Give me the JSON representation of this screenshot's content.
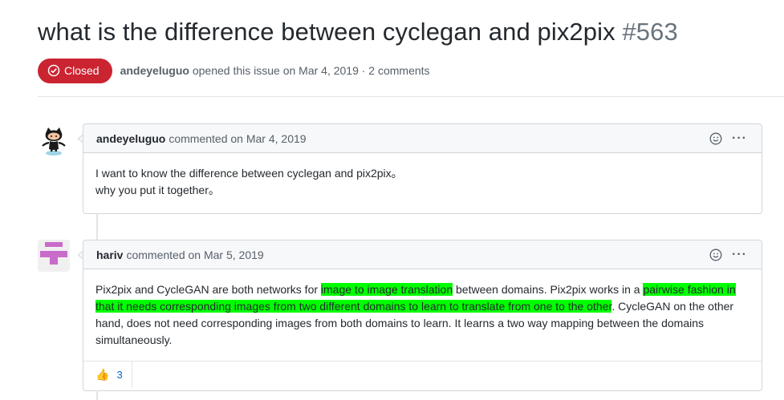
{
  "issue": {
    "title": "what is the difference between cyclegan and pix2pix",
    "number": "#563",
    "state_label": "Closed",
    "author": "andeyeluguo",
    "opened_text": "opened this issue on Mar 4, 2019 · 2 comments",
    "colors": {
      "closed": "#cb2431",
      "highlight": "#00ff00",
      "link": "#0366d6"
    }
  },
  "comments": [
    {
      "author": "andeyeluguo",
      "action": "commented on Mar 4, 2019",
      "avatar_icon": "octocat-icon",
      "lines": [
        "I want to know the difference between cyclegan and pix2pix。",
        "why you put it together。"
      ]
    },
    {
      "author": "hariv",
      "action": "commented on Mar 5, 2019",
      "avatar_icon": "identicon-icon",
      "body": {
        "t1": "Pix2pix and CycleGAN are both networks for ",
        "h1": "image to image translation",
        "t2": " between domains. Pix2pix works in a ",
        "h2": "pairwise fashion in that it needs corresponding images from two different domains to learn to translate from one to the other",
        "t3": ". CycleGAN on the other hand, does not need corresponding images from both domains to learn. It learns a two way mapping between the domains simultaneously."
      },
      "reaction": {
        "icon": "thumbs-up-icon",
        "emoji": "👍",
        "count": "3"
      }
    }
  ],
  "icons": {
    "emoji_button": "smiley-icon",
    "more_button": "kebab-icon",
    "more_glyph": "···"
  }
}
